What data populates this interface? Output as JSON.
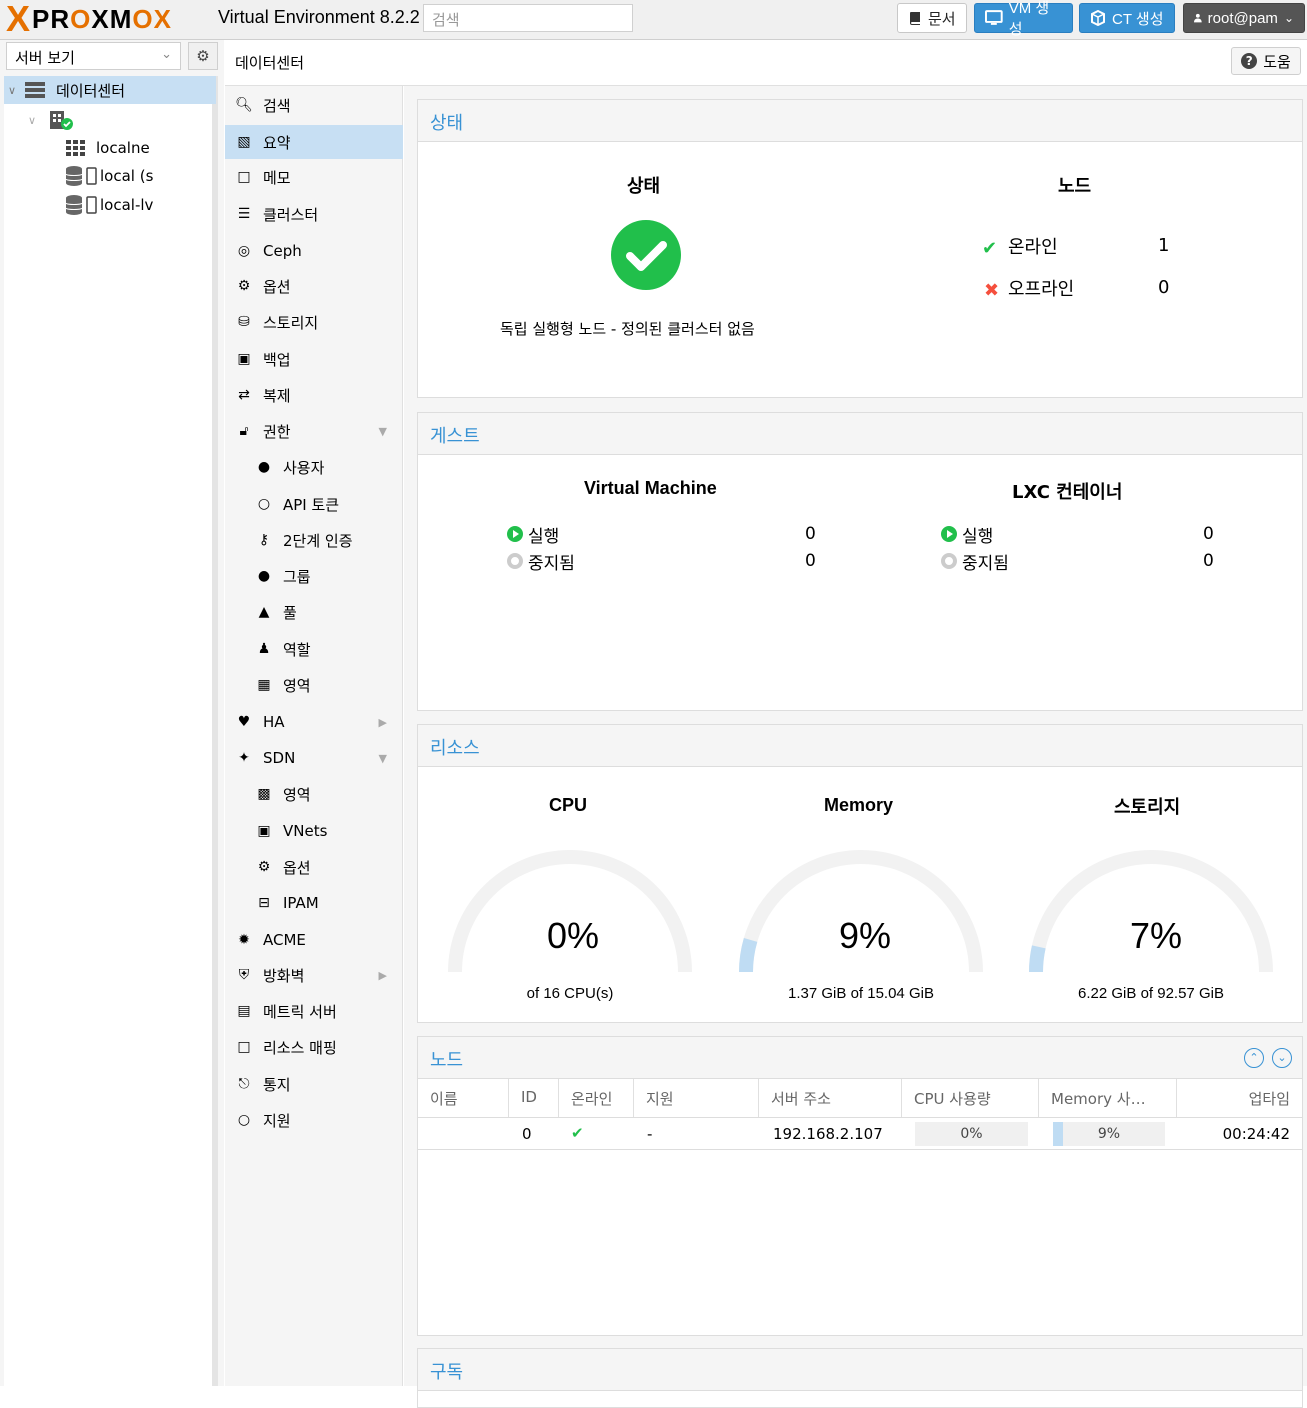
{
  "topbar": {
    "logo_x": "X",
    "logo_pr": "PR",
    "logo_o1": "O",
    "logo_xm": "XM",
    "logo_o2": "O",
    "logo_x2": "X",
    "version": "Virtual Environment 8.2.2",
    "search_placeholder": "검색",
    "docs_label": "문서",
    "vm_label": "VM 생성",
    "ct_label": "CT 생성",
    "user_label": "root@pam"
  },
  "tree": {
    "view_label": "서버 보기",
    "items": [
      {
        "label": "데이터센터"
      },
      {
        "label": ""
      },
      {
        "label": "localne"
      },
      {
        "label": "local (s"
      },
      {
        "label": "local-lv"
      }
    ]
  },
  "breadcrumb": {
    "text": "데이터센터",
    "help_label": "도움"
  },
  "nav": {
    "items": [
      {
        "label": "검색",
        "icon": "search-icon"
      },
      {
        "label": "요약",
        "icon": "book-icon"
      },
      {
        "label": "메모",
        "icon": "note-icon"
      },
      {
        "label": "클러스터",
        "icon": "server-icon"
      },
      {
        "label": "Ceph",
        "icon": "ceph-icon"
      },
      {
        "label": "옵션",
        "icon": "gear-icon"
      },
      {
        "label": "스토리지",
        "icon": "database-icon"
      },
      {
        "label": "백업",
        "icon": "floppy-icon"
      },
      {
        "label": "복제",
        "icon": "retweet-icon"
      },
      {
        "label": "권한",
        "icon": "unlock-icon"
      },
      {
        "label": "사용자",
        "icon": "user-icon"
      },
      {
        "label": "API 토큰",
        "icon": "user-outline-icon"
      },
      {
        "label": "2단계 인증",
        "icon": "key-icon"
      },
      {
        "label": "그룹",
        "icon": "users-icon"
      },
      {
        "label": "풀",
        "icon": "tags-icon"
      },
      {
        "label": "역할",
        "icon": "male-icon"
      },
      {
        "label": "영역",
        "icon": "address-book-icon"
      },
      {
        "label": "HA",
        "icon": "heartbeat-icon"
      },
      {
        "label": "SDN",
        "icon": "sdn-icon"
      },
      {
        "label": "영역",
        "icon": "grid-icon"
      },
      {
        "label": "VNets",
        "icon": "network-icon"
      },
      {
        "label": "옵션",
        "icon": "gear-icon"
      },
      {
        "label": "IPAM",
        "icon": "signpost-icon"
      },
      {
        "label": "ACME",
        "icon": "certificate-icon"
      },
      {
        "label": "방화벽",
        "icon": "shield-icon"
      },
      {
        "label": "메트릭 서버",
        "icon": "bar-chart-icon"
      },
      {
        "label": "리소스 매핑",
        "icon": "folder-icon"
      },
      {
        "label": "통지",
        "icon": "bell-icon"
      },
      {
        "label": "지원",
        "icon": "comments-icon"
      }
    ]
  },
  "status": {
    "title": "상태",
    "status_header": "상태",
    "status_text": "독립 실행형 노드 - 정의된 클러스터 없음",
    "nodes_header": "노드",
    "online_label": "온라인",
    "online_count": "1",
    "offline_label": "오프라인",
    "offline_count": "0"
  },
  "guests": {
    "title": "게스트",
    "vm_header": "Virtual Machine",
    "lxc_header": "LXC 컨테이너",
    "running_label": "실행",
    "stopped_label": "중지됨",
    "vm_running": "0",
    "vm_stopped": "0",
    "lxc_running": "0",
    "lxc_stopped": "0"
  },
  "resources": {
    "title": "리소스",
    "cpu": {
      "header": "CPU",
      "percent": 0,
      "value": "0%",
      "sub": "of 16 CPU(s)"
    },
    "memory": {
      "header": "Memory",
      "percent": 9,
      "value": "9%",
      "sub": "1.37 GiB of 15.04 GiB"
    },
    "storage": {
      "header": "스토리지",
      "percent": 7,
      "value": "7%",
      "sub": "6.22 GiB of 92.57 GiB"
    }
  },
  "nodes": {
    "title": "노드",
    "columns": [
      "이름",
      "ID",
      "온라인",
      "지원",
      "서버 주소",
      "CPU 사용량",
      "Memory 사…",
      "업타임"
    ],
    "row": {
      "name": "",
      "id": "0",
      "support": "-",
      "address": "192.168.2.107",
      "cpu": "0%",
      "cpu_percent": 0,
      "mem": "9%",
      "mem_percent": 9,
      "uptime": "00:24:42"
    }
  },
  "subscription": {
    "title": "구독"
  },
  "colors": {
    "accent": "#3892d4",
    "ok": "#21bf4b",
    "error": "#f54f3d",
    "brand_orange": "#e57000"
  }
}
